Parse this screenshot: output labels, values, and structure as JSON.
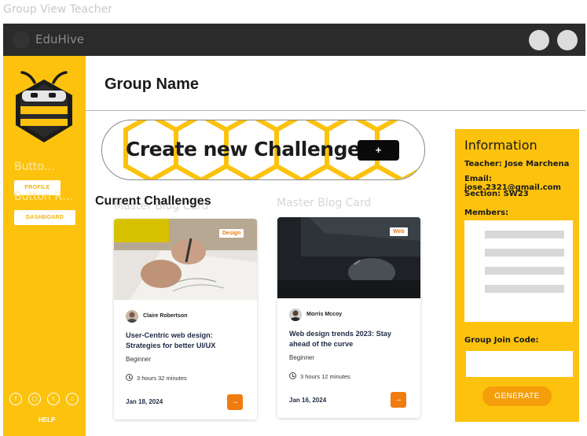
{
  "frame_label": "Group View Teacher",
  "topbar": {
    "brand": "EduHive"
  },
  "sidebar": {
    "faded_labels": [
      "Butto…",
      "Button R…"
    ],
    "buttons": [
      "PROFILE",
      "DASHBOARD"
    ],
    "social_icons": [
      "facebook-icon",
      "instagram-icon",
      "twitter-icon",
      "share-icon"
    ],
    "help": "HELP"
  },
  "header": {
    "title": "Group Name"
  },
  "banner": {
    "label": "Create new Challenge",
    "plus": "+"
  },
  "challenges": {
    "section_title": "Current Challenges",
    "ghost_titles": [
      "Master Blog Card",
      "Master Blog Card"
    ],
    "cards": [
      {
        "tag": "Design",
        "author": "Claire Robertson",
        "title": "User-Centric web design: Strategies for better UI/UX",
        "level": "Beginner",
        "duration": "3 hours 32 minutes",
        "date": "Jan 18, 2024",
        "arrow": "→"
      },
      {
        "tag": "Web",
        "author": "Morris Mccoy",
        "title": "Web design trends 2023: Stay ahead of the curve",
        "level": "Beginner",
        "duration": "3 hours 12 minutes",
        "date": "Jan 16, 2024",
        "arrow": "→"
      }
    ]
  },
  "info": {
    "title": "Information",
    "teacher": "Teacher: Jose Marchena",
    "email": "Email: jose.2321@gmail.com",
    "section": "Section: SW23",
    "members_label": "Members:",
    "join_code_label": "Group Join Code:",
    "join_code_value": "",
    "generate": "GENERATE"
  },
  "colors": {
    "accent": "#fcc20d",
    "orange": "#f07b0f",
    "dark": "#2b2b2b"
  }
}
